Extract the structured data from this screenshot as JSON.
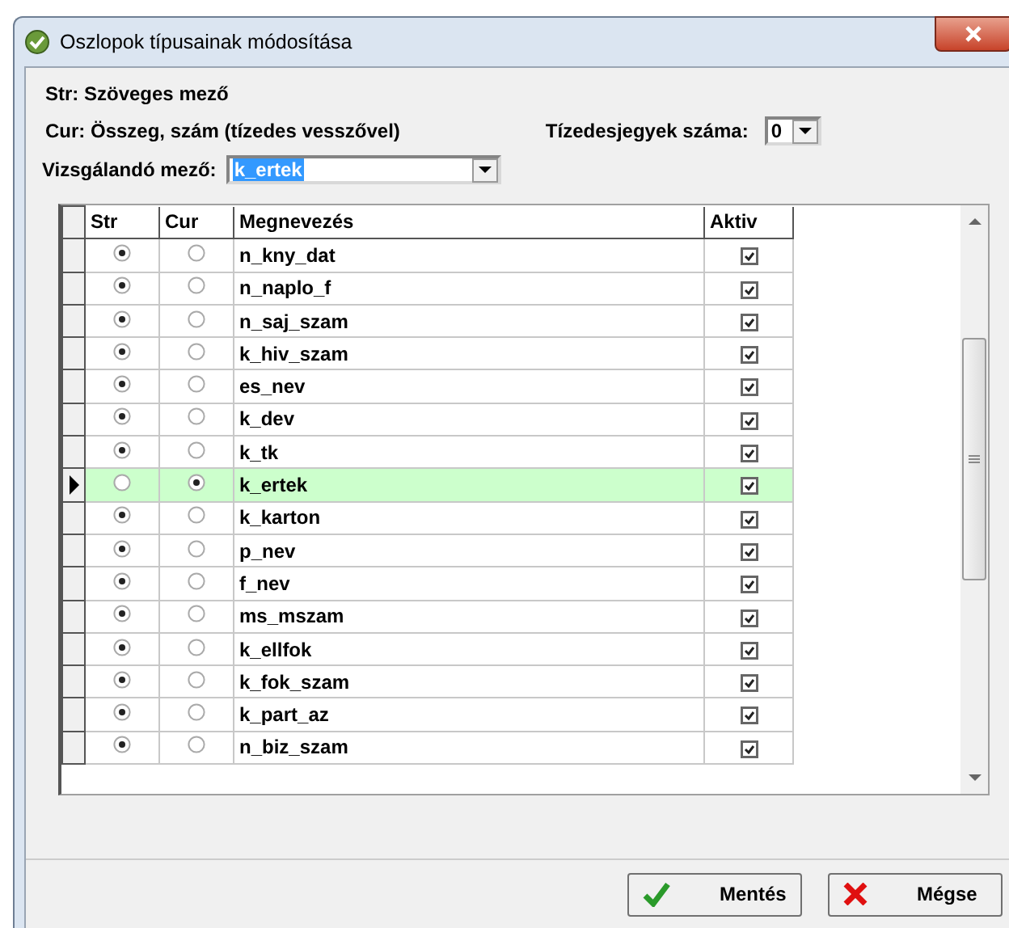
{
  "window": {
    "title": "Oszlopok típusainak módosítása"
  },
  "legend": [
    "Str: Szöveges mező",
    "Cur: Összeg, szám (tízedes vesszővel)"
  ],
  "decimals": {
    "label": "Tízedesjegyek száma:",
    "value": "0"
  },
  "field": {
    "label": "Vizsgálandó mező:",
    "value": "k_ertek"
  },
  "table": {
    "columns": [
      "Str",
      "Cur",
      "Megnevezés",
      "Aktiv"
    ],
    "rows": [
      {
        "name": "n_kny_dat",
        "str": true,
        "cur": false,
        "aktiv": true,
        "selected": false
      },
      {
        "name": "n_naplo_f",
        "str": true,
        "cur": false,
        "aktiv": true,
        "selected": false
      },
      {
        "name": "n_saj_szam",
        "str": true,
        "cur": false,
        "aktiv": true,
        "selected": false
      },
      {
        "name": "k_hiv_szam",
        "str": true,
        "cur": false,
        "aktiv": true,
        "selected": false
      },
      {
        "name": "es_nev",
        "str": true,
        "cur": false,
        "aktiv": true,
        "selected": false
      },
      {
        "name": "k_dev",
        "str": true,
        "cur": false,
        "aktiv": true,
        "selected": false
      },
      {
        "name": "k_tk",
        "str": true,
        "cur": false,
        "aktiv": true,
        "selected": false
      },
      {
        "name": "k_ertek",
        "str": false,
        "cur": true,
        "aktiv": true,
        "selected": true
      },
      {
        "name": "k_karton",
        "str": true,
        "cur": false,
        "aktiv": true,
        "selected": false
      },
      {
        "name": "p_nev",
        "str": true,
        "cur": false,
        "aktiv": true,
        "selected": false
      },
      {
        "name": "f_nev",
        "str": true,
        "cur": false,
        "aktiv": true,
        "selected": false
      },
      {
        "name": "ms_mszam",
        "str": true,
        "cur": false,
        "aktiv": true,
        "selected": false
      },
      {
        "name": "k_ellfok",
        "str": true,
        "cur": false,
        "aktiv": true,
        "selected": false
      },
      {
        "name": "k_fok_szam",
        "str": true,
        "cur": false,
        "aktiv": true,
        "selected": false
      },
      {
        "name": "k_part_az",
        "str": true,
        "cur": false,
        "aktiv": true,
        "selected": false
      },
      {
        "name": "n_biz_szam",
        "str": true,
        "cur": false,
        "aktiv": true,
        "selected": false
      }
    ]
  },
  "buttons": [
    {
      "label": "Mentés",
      "kind": "save"
    },
    {
      "label": "Mégse",
      "kind": "cancel"
    }
  ]
}
